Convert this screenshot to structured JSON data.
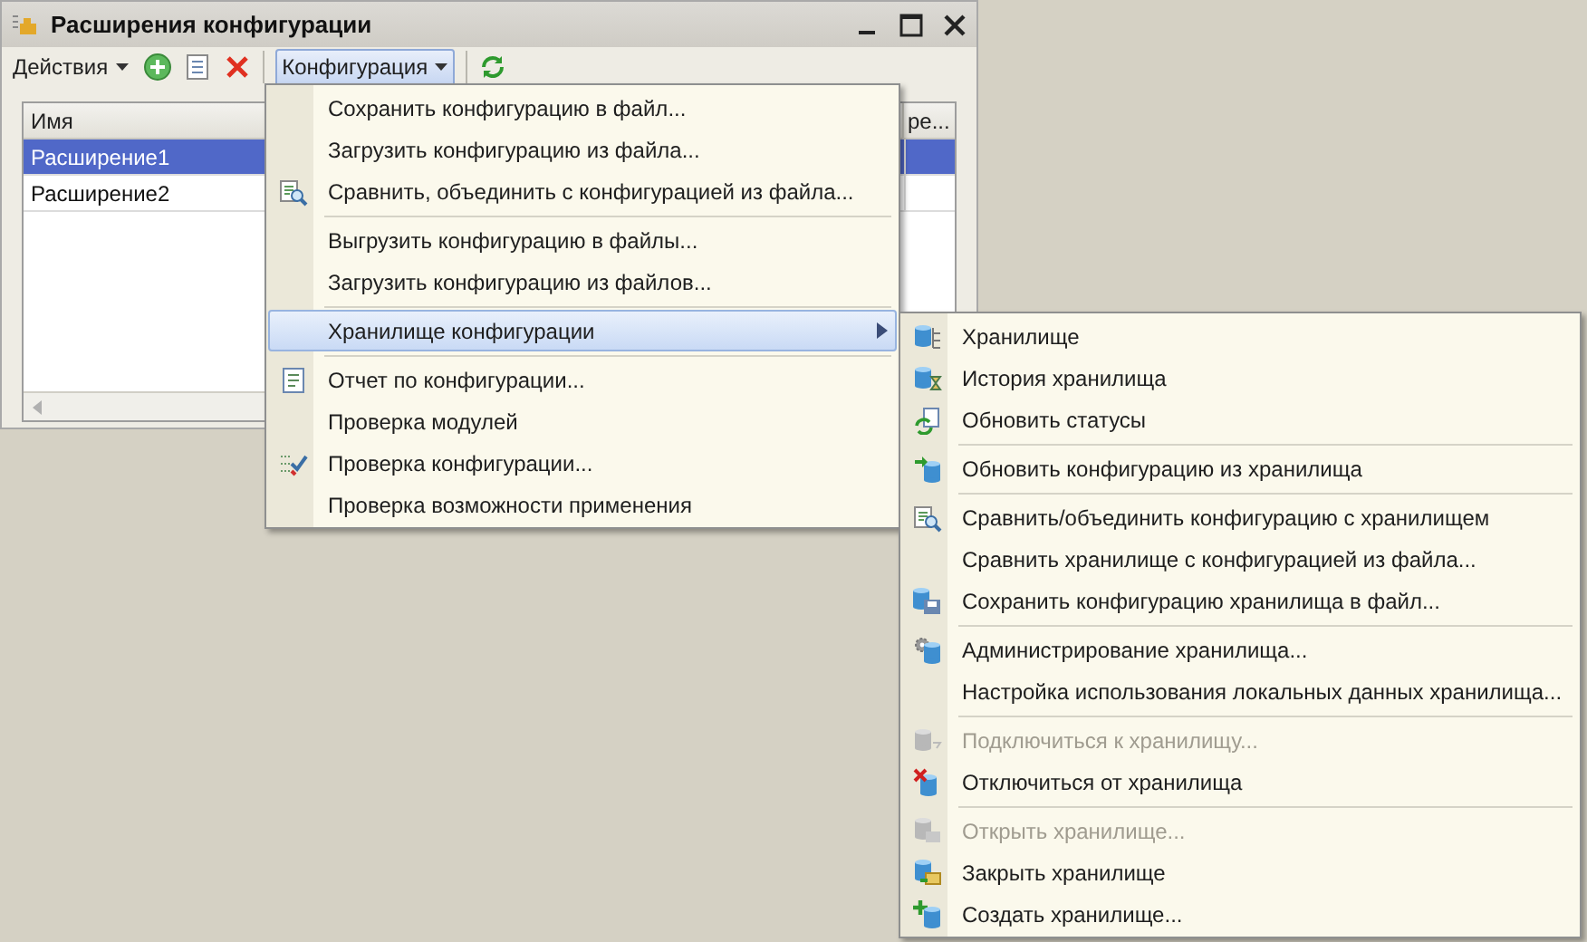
{
  "window": {
    "title": "Расширения конфигурации"
  },
  "toolbar": {
    "actions": {
      "label": "Действия"
    },
    "configuration": {
      "label": "Конфигурация",
      "selected": true
    }
  },
  "table": {
    "columns": [
      "Имя",
      "ре..."
    ],
    "rows": [
      {
        "name": "Расширение1",
        "selected": true
      },
      {
        "name": "Расширение2",
        "selected": false
      }
    ]
  },
  "menu": {
    "groups": [
      [
        {
          "label": "Сохранить конфигурацию в файл...",
          "selected": false,
          "submenu": false
        },
        {
          "label": "Загрузить конфигурацию из файла...",
          "selected": false,
          "submenu": false
        },
        {
          "label": "Сравнить, объединить с конфигурацией из файла...",
          "selected": false,
          "submenu": false
        }
      ],
      [
        {
          "label": "Выгрузить конфигурацию в файлы...",
          "selected": false,
          "submenu": false
        },
        {
          "label": "Загрузить конфигурацию из файлов...",
          "selected": false,
          "submenu": false
        }
      ],
      [
        {
          "label": "Хранилище конфигурации",
          "selected": true,
          "submenu": true
        }
      ],
      [
        {
          "label": "Отчет по конфигурации...",
          "selected": false,
          "submenu": false
        },
        {
          "label": "Проверка модулей",
          "selected": false,
          "submenu": false
        },
        {
          "label": "Проверка конфигурации...",
          "selected": false,
          "submenu": false
        },
        {
          "label": "Проверка возможности применения",
          "selected": false,
          "submenu": false
        }
      ]
    ]
  },
  "submenu": {
    "groups": [
      [
        {
          "label": "Хранилище",
          "disabled": false
        },
        {
          "label": "История хранилища",
          "disabled": false
        },
        {
          "label": "Обновить статусы",
          "disabled": false
        }
      ],
      [
        {
          "label": "Обновить конфигурацию из хранилища",
          "disabled": false
        }
      ],
      [
        {
          "label": "Сравнить/объединить конфигурацию с хранилищем",
          "disabled": false
        },
        {
          "label": "Сравнить хранилище с конфигурацией из файла...",
          "disabled": false
        },
        {
          "label": "Сохранить конфигурацию хранилища в файл...",
          "disabled": false
        }
      ],
      [
        {
          "label": "Администрирование хранилища...",
          "disabled": false
        },
        {
          "label": "Настройка использования локальных данных хранилища...",
          "disabled": false
        }
      ],
      [
        {
          "label": "Подключиться к хранилищу...",
          "disabled": true
        },
        {
          "label": "Отключиться от хранилища",
          "disabled": false
        }
      ],
      [
        {
          "label": "Открыть хранилище...",
          "disabled": true
        },
        {
          "label": "Закрыть хранилище",
          "disabled": false
        },
        {
          "label": "Создать хранилище...",
          "disabled": false
        }
      ]
    ]
  }
}
